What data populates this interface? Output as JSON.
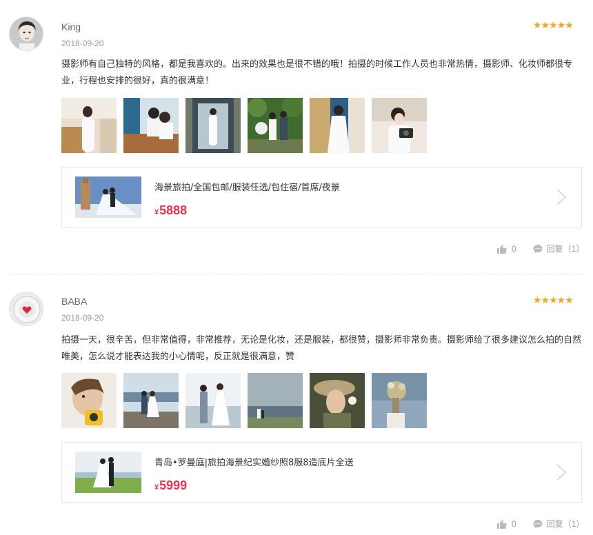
{
  "reviews": [
    {
      "username": "King",
      "date": "2018-09-20",
      "rating_stars": "★★★★★",
      "content": "摄影师有自己独特的风格，都是我喜欢的。出来的效果也是很不错的哦！拍摄的时候工作人员也非常热情，摄影师、化妆师都很专业，行程也安排的很好，真的很满意！",
      "product": {
        "name": "海景旅拍/全国包邮/服装任选/包住宿/首席/夜景",
        "currency": "¥",
        "price": "5888"
      },
      "likes": "0",
      "reply_label": "回复（1）"
    },
    {
      "username": "BABA",
      "date": "2018-09-20",
      "rating_stars": "★★★★★",
      "content": "拍摄一天，很辛苦，但非常值得，非常推荐，无论是化妆，还是服装，都很赞，摄影师非常负责。摄影师给了很多建议怎么拍的自然唯美，怎么说才能表达我的小心情呢，反正就是很满意，赞",
      "product": {
        "name": "青岛•罗曼庭|旅拍海景纪实婚纱照8服8造底片全送",
        "currency": "¥",
        "price": "5999"
      },
      "likes": "0",
      "reply_label": "回复（1）"
    }
  ],
  "colors": {
    "star": "#f5a623",
    "price": "#e8344e",
    "muted": "#999999"
  },
  "icons": {
    "like": "thumbs-up-icon",
    "reply": "chat-bubble-icon",
    "chevron": "chevron-right-icon"
  }
}
